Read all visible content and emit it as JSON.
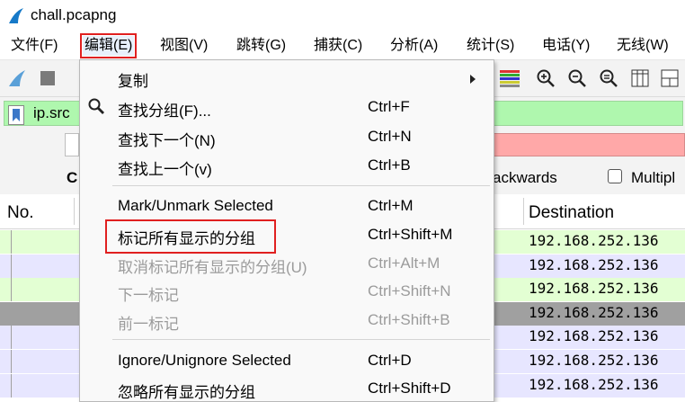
{
  "window": {
    "title": "chall.pcapng"
  },
  "menubar": [
    {
      "label": "文件(F)"
    },
    {
      "label": "编辑(E)"
    },
    {
      "label": "视图(V)"
    },
    {
      "label": "跳转(G)"
    },
    {
      "label": "捕获(C)"
    },
    {
      "label": "分析(A)"
    },
    {
      "label": "统计(S)"
    },
    {
      "label": "电话(Y)"
    },
    {
      "label": "无线(W)"
    }
  ],
  "filter": {
    "value": "ip.src",
    "color": "#aff7ae"
  },
  "search": {
    "options_label": "ackwards",
    "multiple_label": "Multipl",
    "left_label": "C"
  },
  "packet_list": {
    "col_no": "No.",
    "col_destination": "Destination",
    "rows": [
      {
        "destination": "192.168.252.136",
        "bg": "#e3ffd3"
      },
      {
        "destination": "192.168.252.136",
        "bg": "#e7e6ff"
      },
      {
        "destination": "192.168.252.136",
        "bg": "#e3ffd3"
      },
      {
        "destination": "192.168.252.136",
        "bg": "#a0a0a0"
      },
      {
        "destination": "192.168.252.136",
        "bg": "#e7e6ff"
      },
      {
        "destination": "192.168.252.136",
        "bg": "#e7e6ff"
      },
      {
        "destination": "192.168.252.136",
        "bg": "#e7e6ff"
      }
    ]
  },
  "edit_menu": {
    "items": [
      {
        "label": "复制",
        "shortcut": "",
        "submenu": true,
        "enabled": true
      },
      {
        "label": "查找分组(F)...",
        "shortcut": "Ctrl+F",
        "enabled": true,
        "icon": "magnifier-icon"
      },
      {
        "label": "查找下一个(N)",
        "shortcut": "Ctrl+N",
        "enabled": true
      },
      {
        "label": "查找上一个(v)",
        "shortcut": "Ctrl+B",
        "enabled": true
      },
      {
        "label": "Mark/Unmark Selected",
        "shortcut": "Ctrl+M",
        "enabled": true
      },
      {
        "label": "标记所有显示的分组",
        "shortcut": "Ctrl+Shift+M",
        "enabled": true
      },
      {
        "label": "取消标记所有显示的分组(U)",
        "shortcut": "Ctrl+Alt+M",
        "enabled": false
      },
      {
        "label": "下一标记",
        "shortcut": "Ctrl+Shift+N",
        "enabled": false
      },
      {
        "label": "前一标记",
        "shortcut": "Ctrl+Shift+B",
        "enabled": false
      },
      {
        "label": "Ignore/Unignore Selected",
        "shortcut": "Ctrl+D",
        "enabled": true
      },
      {
        "label": "忽略所有显示的分组",
        "shortcut": "Ctrl+Shift+D",
        "enabled": true
      }
    ]
  },
  "colors": {
    "highlight": "#e02020",
    "search_error": "#ffa8a8",
    "filter_ok": "#aff7ae"
  }
}
